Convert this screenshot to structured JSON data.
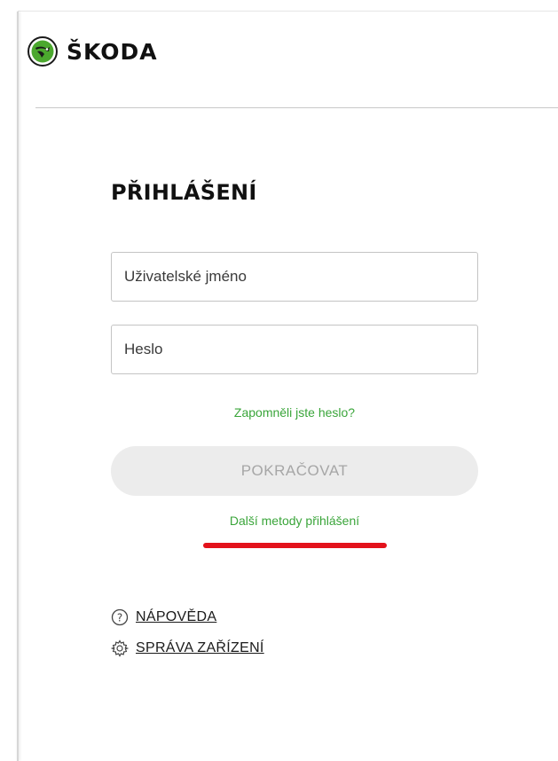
{
  "brand": {
    "name": "ŠKODA",
    "accent_color": "#3aa53a",
    "logo_icon": "skoda-winged-arrow-icon"
  },
  "login": {
    "title": "PŘIHLÁŠENÍ",
    "username_placeholder": "Uživatelské jméno",
    "password_placeholder": "Heslo",
    "forgot_password": "Zapomněli jste heslo?",
    "continue_label": "POKRAČOVAT",
    "other_methods": "Další metody přihlášení",
    "annotation_color": "#e3121b"
  },
  "footer_links": {
    "help_label": "NÁPOVĚDA",
    "help_icon": "question-circle-icon",
    "devices_label": "SPRÁVA ZAŘÍZENÍ",
    "devices_icon": "gear-icon"
  }
}
